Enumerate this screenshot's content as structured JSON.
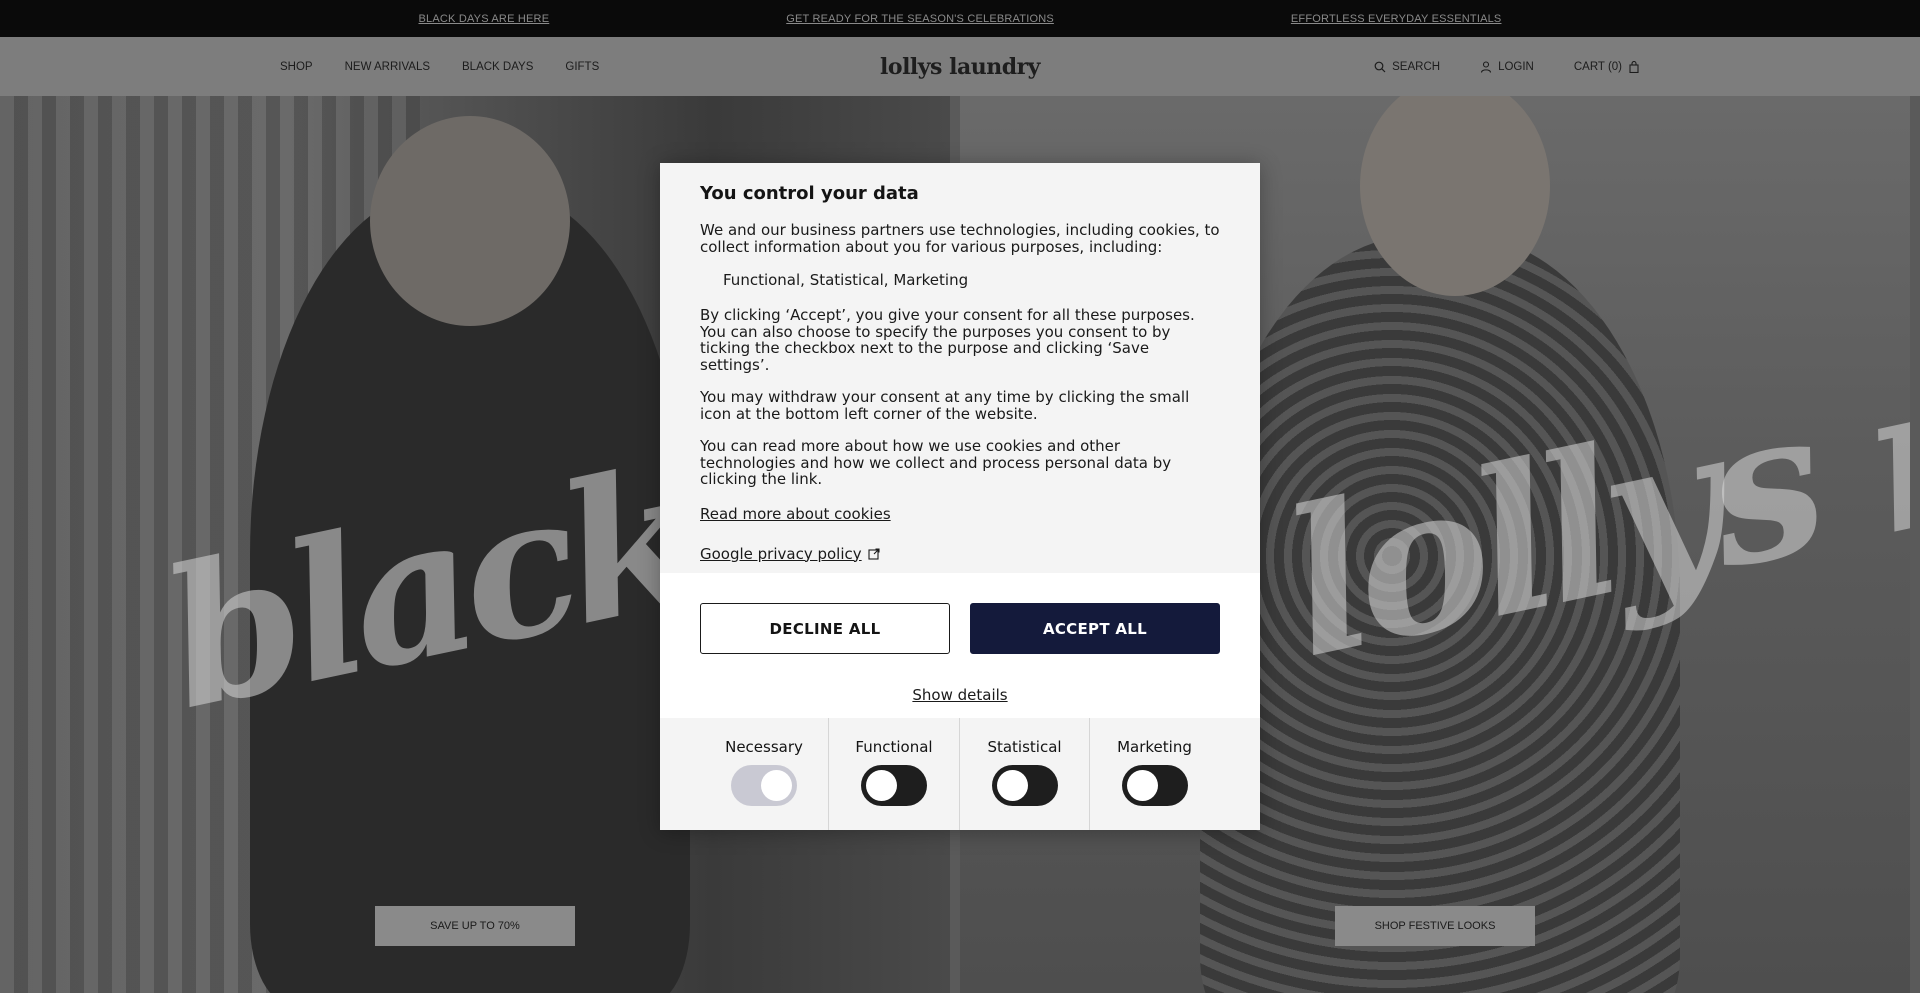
{
  "announcements": [
    "BLACK DAYS ARE HERE",
    "GET READY FOR THE SEASON'S CELEBRATIONS",
    "EFFORTLESS EVERYDAY ESSENTIALS"
  ],
  "nav": {
    "left": [
      "SHOP",
      "NEW ARRIVALS",
      "BLACK DAYS",
      "GIFTS"
    ],
    "logo": "lollys laundry",
    "search": "SEARCH",
    "login": "LOGIN",
    "cart": "CART (0)"
  },
  "hero": {
    "left_script": "black days",
    "left_cta": "SAVE UP TO 70%",
    "right_script": "lollys news",
    "right_cta": "SHOP FESTIVE LOOKS"
  },
  "consent": {
    "title": "You control your data",
    "intro": "We and our business partners use technologies, including cookies, to collect information about you for various purposes, including:",
    "purposes": "Functional,  Statistical,  Marketing",
    "consent_text": "By clicking ‘Accept’, you give your consent for all these purposes. You can also choose to specify the purposes you consent to by ticking the checkbox next to the purpose and clicking ‘Save settings’.",
    "withdraw_text": "You may withdraw your consent at any time by clicking the small icon at the bottom left corner of the website.",
    "readmore_text": "You can read more about how we use cookies and other technologies and how we collect and process personal data by clicking the link.",
    "cookies_link": "Read more about cookies",
    "google_link": "Google privacy policy",
    "decline_label": "DECLINE ALL",
    "accept_label": "ACCEPT ALL",
    "show_details": "Show details",
    "toggles": [
      {
        "label": "Necessary",
        "state": "on-disabled"
      },
      {
        "label": "Functional",
        "state": "off"
      },
      {
        "label": "Statistical",
        "state": "off"
      },
      {
        "label": "Marketing",
        "state": "off"
      }
    ]
  },
  "colors": {
    "accept_button": "#141a3b",
    "announcement_bar": "#0a0a0a"
  }
}
